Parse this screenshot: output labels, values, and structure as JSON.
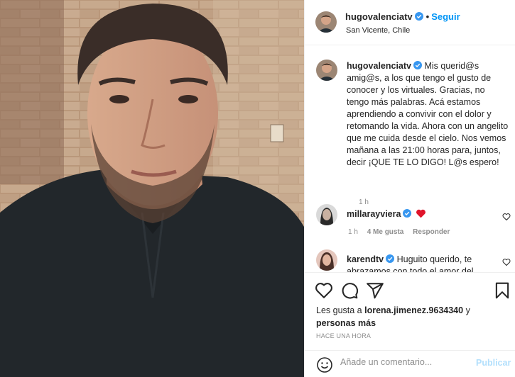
{
  "post": {
    "username": "hugovalenciatv",
    "location": "San Vicente, Chile",
    "follow_label": "Seguir",
    "dot": "•"
  },
  "caption": {
    "username": "hugovalenciatv",
    "text": "Mis querid@s amig@s, a los que tengo el gusto de conocer y los virtuales. Gracias, no tengo más palabras. Acá estamos aprendiendo a convivir con el dolor y retomando la vida. Ahora con un angelito que me cuida desde el cielo. Nos vemos mañana a las 21:00 horas para, juntos, decir ¡QUE TE LO DIGO! L@s espero!",
    "time": "1 h"
  },
  "comments": [
    {
      "username": "millarayviera",
      "text": "",
      "time": "1 h",
      "likes": "4 Me gusta",
      "reply": "Responder"
    },
    {
      "username": "karendtv",
      "text": "Huguito querido, te abrazamos con todo el amor del"
    }
  ],
  "likes": {
    "prefix": "Les gusta a ",
    "user": "lorena.jimenez.9634340",
    "middle": " y",
    "others": "personas más"
  },
  "posted_ago": "HACE UNA HORA",
  "add_comment": {
    "placeholder": "Añade un comentario...",
    "publish_label": "Publicar"
  },
  "colors": {
    "accent": "#0095f6",
    "verified": "#3897f0",
    "heart": "#ed4956",
    "muted": "#8e8e8e",
    "publish_disabled": "#b2dffc"
  },
  "icons": [
    "verified-badge-icon",
    "heart-outline-icon",
    "heart-emoji-icon",
    "comment-icon",
    "share-icon",
    "bookmark-icon",
    "emoji-icon"
  ]
}
